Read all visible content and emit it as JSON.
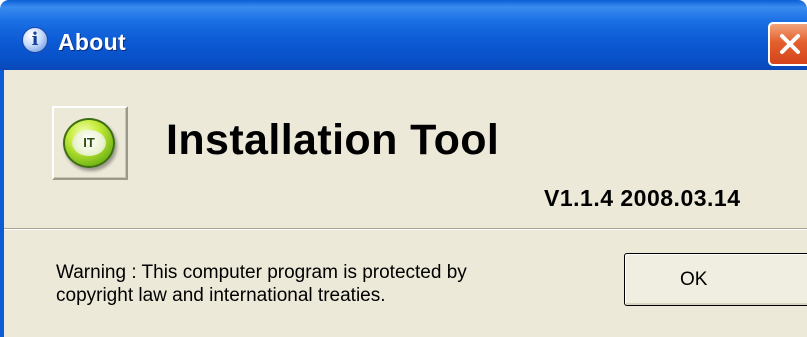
{
  "window": {
    "title": "About",
    "title_icon_glyph": "i",
    "title_icon": "info-icon",
    "close_icon": "close-icon",
    "accent_color": "#0c5ad4",
    "close_color": "#e4602e"
  },
  "app": {
    "icon": "installation-tool-logo-icon",
    "icon_label": "IT",
    "name": "Installation Tool",
    "version": "V1.1.4 2008.03.14"
  },
  "footer": {
    "warning_line1": "Warning : This computer program is protected by",
    "warning_line2": "copyright law and international treaties.",
    "ok_label": "OK"
  }
}
